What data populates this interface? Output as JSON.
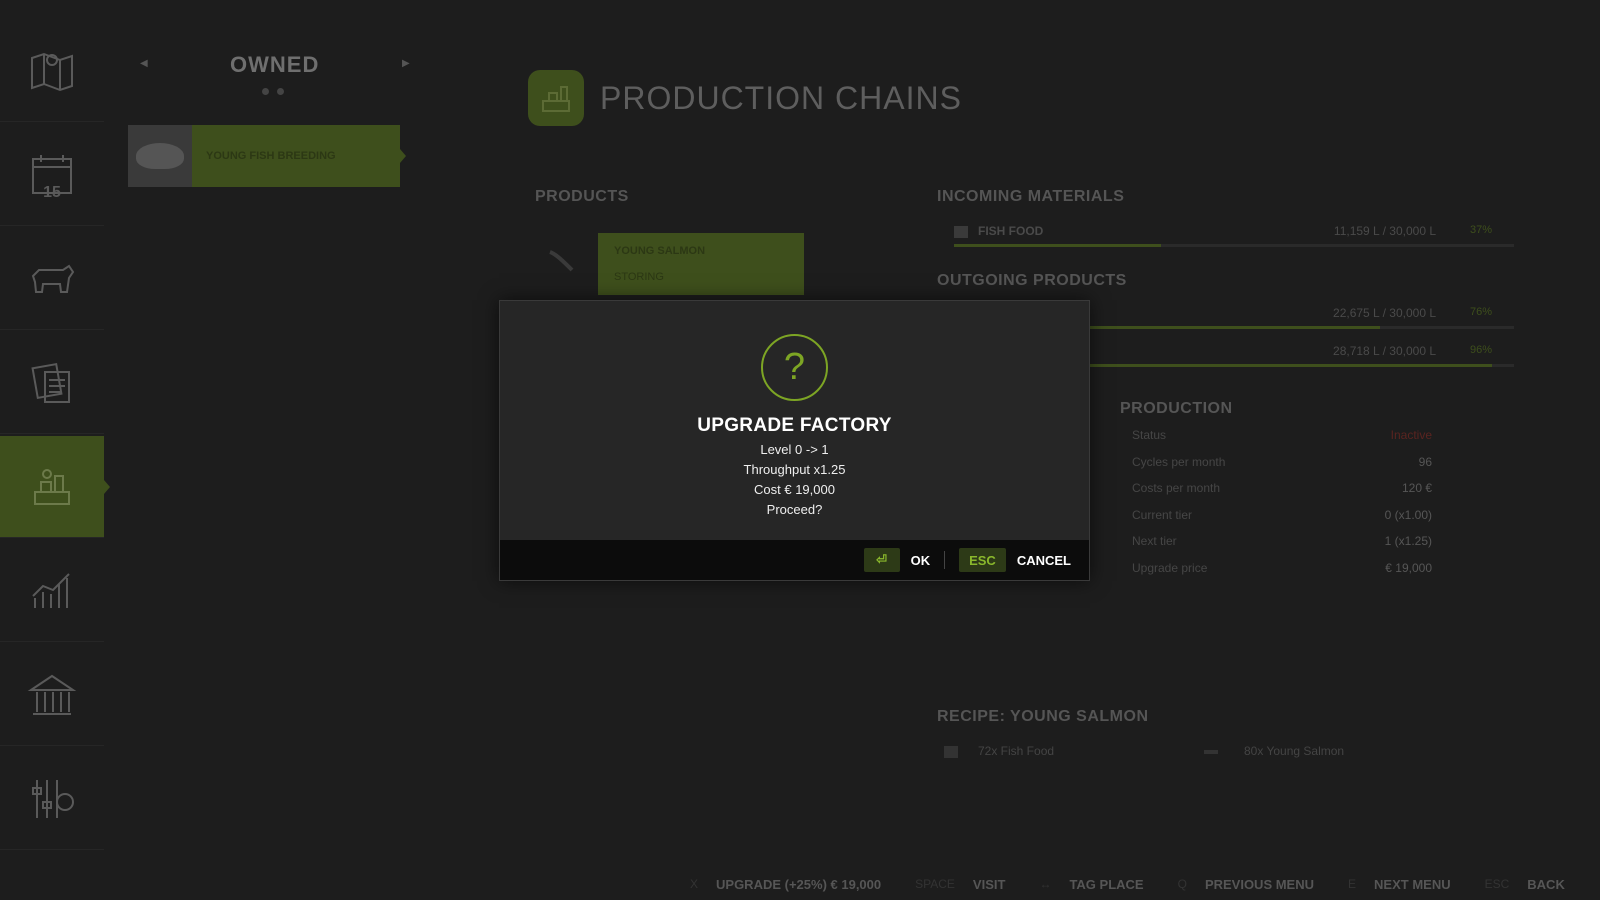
{
  "owned": {
    "title": "OWNED",
    "items": [
      {
        "label": "YOUNG FISH BREEDING"
      }
    ]
  },
  "header": {
    "title": "PRODUCTION CHAINS"
  },
  "products": {
    "heading": "PRODUCTS",
    "card": {
      "name": "YOUNG SALMON",
      "mode": "STORING"
    }
  },
  "incoming": {
    "heading": "INCOMING MATERIALS",
    "items": [
      {
        "name": "FISH FOOD",
        "value": "11,159 L / 30,000 L",
        "percent": "37%",
        "fill": 0.37
      }
    ]
  },
  "outgoing": {
    "heading": "OUTGOING PRODUCTS",
    "items": [
      {
        "value": "22,675 L / 30,000 L",
        "percent": "76%",
        "fill": 0.76
      },
      {
        "value": "28,718 L / 30,000 L",
        "percent": "96%",
        "fill": 0.96
      }
    ]
  },
  "production": {
    "heading": "PRODUCTION",
    "rows": [
      {
        "label": "Status",
        "value": "Inactive"
      },
      {
        "label": "Cycles per month",
        "value": "96"
      },
      {
        "label": "Costs per month",
        "value": "120 €"
      },
      {
        "label": "Current tier",
        "value": "0 (x1.00)"
      },
      {
        "label": "Next tier",
        "value": "1 (x1.25)"
      },
      {
        "label": "Upgrade price",
        "value": "€ 19,000"
      }
    ]
  },
  "recipe": {
    "heading": "RECIPE: YOUNG SALMON",
    "input": "72x Fish Food",
    "output": "80x Young Salmon"
  },
  "dialog": {
    "icon": "question-icon",
    "icon_glyph": "?",
    "title": "UPGRADE FACTORY",
    "lines": [
      "Level 0 -> 1",
      "Throughput x1.25",
      "Cost € 19,000",
      "Proceed?"
    ],
    "ok_key": "⏎",
    "ok_label": "OK",
    "cancel_key": "ESC",
    "cancel_label": "CANCEL"
  },
  "bottombar": [
    {
      "key": "X",
      "label": "UPGRADE (+25%) € 19,000"
    },
    {
      "key": "SPACE",
      "label": "VISIT"
    },
    {
      "key": "↔",
      "label": "TAG PLACE"
    },
    {
      "key": "Q",
      "label": "PREVIOUS MENU"
    },
    {
      "key": "E",
      "label": "NEXT MENU"
    },
    {
      "key": "ESC",
      "label": "BACK"
    }
  ],
  "sidebar": {
    "items": [
      {
        "icon": "map-icon"
      },
      {
        "icon": "calendar-icon",
        "number": "15"
      },
      {
        "icon": "animals-icon"
      },
      {
        "icon": "contracts-icon"
      },
      {
        "icon": "production-icon",
        "active": true
      },
      {
        "icon": "statistics-icon"
      },
      {
        "icon": "finances-icon"
      },
      {
        "icon": "settings-icon"
      }
    ]
  },
  "colors": {
    "accent": "#7da524",
    "accent_dark": "#3e4f1c",
    "background": "#1d1d1d"
  }
}
